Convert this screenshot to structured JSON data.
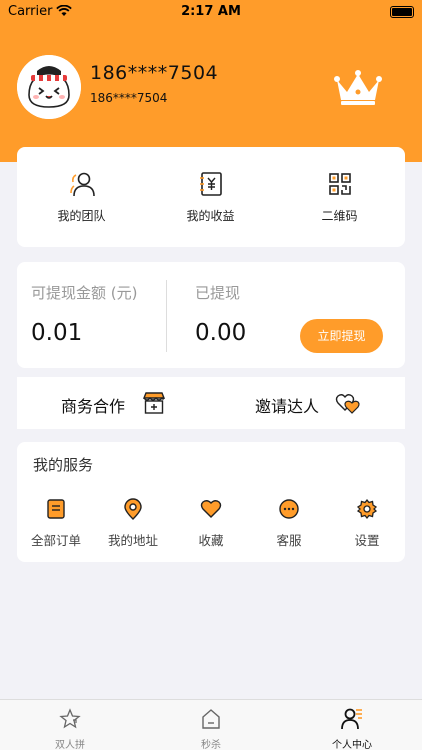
{
  "status_bar": {
    "carrier": "Carrier",
    "time": "2:17 AM"
  },
  "profile": {
    "username": "186****7504",
    "phone": "186****7504"
  },
  "quick_actions": [
    {
      "label": "我的团队",
      "icon": "team-icon"
    },
    {
      "label": "我的收益",
      "icon": "earnings-icon"
    },
    {
      "label": "二维码",
      "icon": "qr-code-icon"
    }
  ],
  "wallet": {
    "withdrawable_label": "可提现金额 (元)",
    "withdrawable_value": "0.01",
    "withdrawn_label": "已提现",
    "withdrawn_value": "0.00",
    "withdraw_button": "立即提现"
  },
  "business": {
    "cooperation_label": "商务合作",
    "invite_label": "邀请达人"
  },
  "services": {
    "title": "我的服务",
    "items": [
      {
        "label": "全部订单",
        "icon": "orders-icon"
      },
      {
        "label": "我的地址",
        "icon": "address-icon"
      },
      {
        "label": "收藏",
        "icon": "favorite-icon"
      },
      {
        "label": "客服",
        "icon": "customer-service-icon"
      },
      {
        "label": "设置",
        "icon": "settings-icon"
      }
    ]
  },
  "tabbar": [
    {
      "label": "双人拼",
      "icon": "group-buy-icon",
      "active": false
    },
    {
      "label": "秒杀",
      "icon": "flash-sale-icon",
      "active": false
    },
    {
      "label": "个人中心",
      "icon": "profile-icon",
      "active": true
    }
  ],
  "colors": {
    "accent": "#ff9c2a",
    "background": "#f2f2f7"
  }
}
